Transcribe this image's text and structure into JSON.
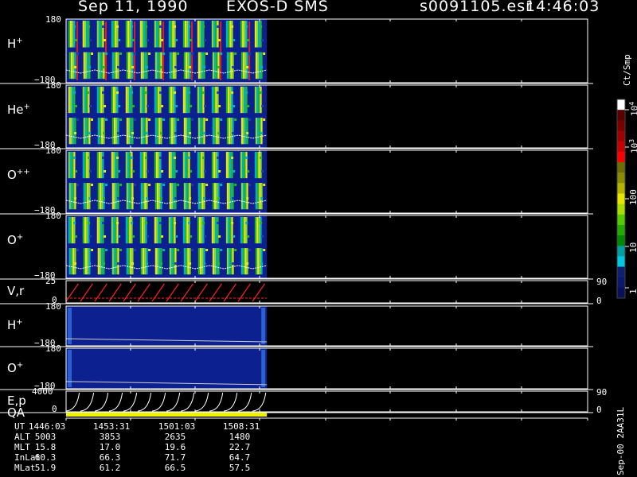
{
  "header": {
    "date": "Sep 11, 1990",
    "instrument": "EXOS-D SMS",
    "file": "s0091105.esr",
    "time": "14:46:03"
  },
  "panels": [
    {
      "id": "h-plus",
      "name": "H",
      "sup": "+",
      "top": "180",
      "bottom": "−180"
    },
    {
      "id": "he-plus",
      "name": "He",
      "sup": "+",
      "top": "180",
      "bottom": "−180"
    },
    {
      "id": "o-plusplus",
      "name": "O",
      "sup": "++",
      "top": "180",
      "bottom": "−180"
    },
    {
      "id": "o-plus",
      "name": "O",
      "sup": "+",
      "top": "180",
      "bottom": "−180"
    },
    {
      "id": "vr",
      "name": "V,r",
      "sup": "",
      "top": "25",
      "bottom": "0",
      "right_top": "90",
      "right_bottom": "0"
    },
    {
      "id": "h-plus-2",
      "name": "H",
      "sup": "+",
      "top": "180",
      "bottom": "−180"
    },
    {
      "id": "o-plus-2",
      "name": "O",
      "sup": "+",
      "top": "180",
      "bottom": "−180"
    },
    {
      "id": "ep",
      "name": "E,p",
      "sup": "",
      "top": "4000",
      "bottom": "0",
      "right_top": "90",
      "right_bottom": "0"
    }
  ],
  "qa_label": "QA",
  "colorbar": {
    "unit": "Ct/Smp",
    "ticks": [
      {
        "label": "10",
        "sup": "4"
      },
      {
        "label": "10",
        "sup": "3"
      },
      {
        "label": "100",
        "sup": ""
      },
      {
        "label": "10",
        "sup": ""
      },
      {
        "label": "1",
        "sup": ""
      }
    ],
    "colors": [
      "#ffffff",
      "#5a0000",
      "#7a0000",
      "#a00000",
      "#c80000",
      "#ff0000",
      "#6e6e00",
      "#8c8c00",
      "#b4b400",
      "#e6e600",
      "#aadd00",
      "#55cc00",
      "#22aa00",
      "#008800",
      "#00a0a0",
      "#00c8e0",
      "#102070",
      "#0a1870",
      "#081058"
    ]
  },
  "footer": {
    "rows": [
      {
        "label": "UT",
        "values": [
          "1446:03",
          "1453:31",
          "1501:03",
          "1508:31"
        ]
      },
      {
        "label": "ALT",
        "values": [
          "5003",
          "3853",
          "2635",
          "1480"
        ]
      },
      {
        "label": "MLT",
        "values": [
          "15.8",
          "17.0",
          "19.6",
          "22.7"
        ]
      },
      {
        "label": "InLat",
        "values": [
          "60.3",
          "66.3",
          "71.7",
          "64.7"
        ]
      },
      {
        "label": "MLat",
        "values": [
          "51.9",
          "61.2",
          "66.5",
          "57.5"
        ]
      }
    ],
    "stamp": "Sep-00 2AA31L"
  },
  "chart_data": {
    "type": "heatmap",
    "title": "Sep 11, 1990  EXOS-D SMS",
    "xlabel": "UT",
    "x_ticks": [
      "1446:03",
      "1453:31",
      "1501:03",
      "1508:31"
    ],
    "data_extent_fraction": 0.385,
    "spin_cycles": 14,
    "series": [
      {
        "name": "H+",
        "ylim": [
          -180,
          180
        ]
      },
      {
        "name": "He+",
        "ylim": [
          -180,
          180
        ]
      },
      {
        "name": "O++",
        "ylim": [
          -180,
          180
        ]
      },
      {
        "name": "O+",
        "ylim": [
          -180,
          180
        ]
      },
      {
        "name": "V,r",
        "ylim": [
          0,
          25
        ],
        "ylim_right": [
          0,
          90
        ]
      },
      {
        "name": "H+",
        "ylim": [
          -180,
          180
        ]
      },
      {
        "name": "O+",
        "ylim": [
          -180,
          180
        ]
      },
      {
        "name": "E,p",
        "ylim": [
          0,
          4000
        ],
        "ylim_right": [
          0,
          90
        ]
      }
    ],
    "colorscale": {
      "unit": "Ct/Smp",
      "scale": "log",
      "range": [
        1,
        10000
      ]
    }
  }
}
